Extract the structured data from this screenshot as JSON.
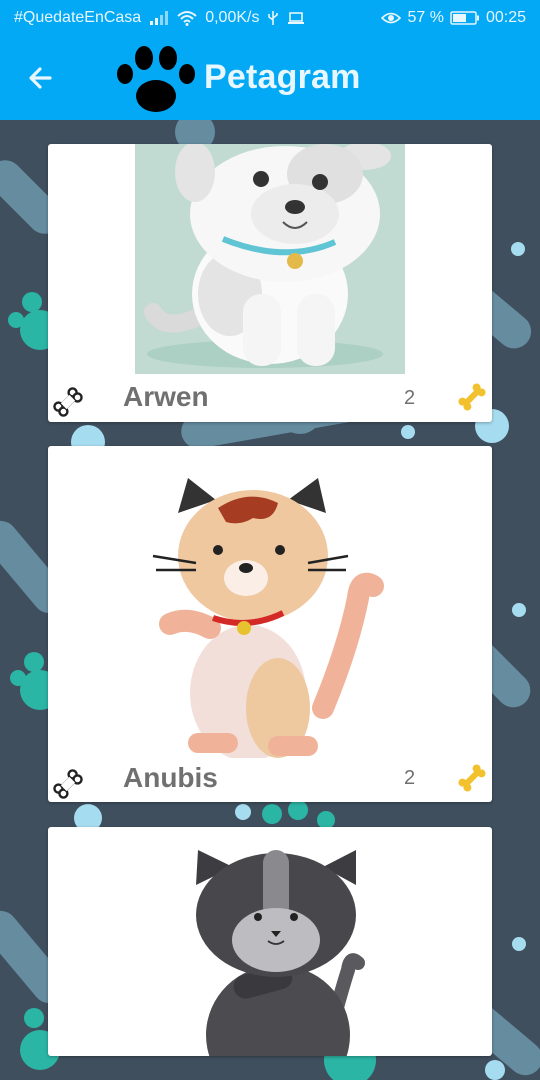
{
  "status_bar": {
    "hashtag": "#QuedateEnCasa",
    "speed": "0,00K/s",
    "battery": "57 %",
    "time": "00:25",
    "icons": [
      "signal-icon",
      "wifi-icon",
      "usb-icon",
      "laptop-icon",
      "eye-icon",
      "battery-icon"
    ]
  },
  "app_bar": {
    "title": "Petagram",
    "icons": [
      "back-arrow-icon",
      "paw-logo-icon"
    ]
  },
  "colors": {
    "primary": "#03a9f4",
    "background": "#3f4f5e",
    "name_text": "#707070",
    "bone_gold": "#f2c12e"
  },
  "pets": [
    {
      "name": "Arwen",
      "likes": "2",
      "image": "dog-illustration"
    },
    {
      "name": "Anubis",
      "likes": "2",
      "image": "cat-illustration"
    },
    {
      "name": "",
      "likes": "",
      "image": "gray-cat-illustration"
    }
  ]
}
